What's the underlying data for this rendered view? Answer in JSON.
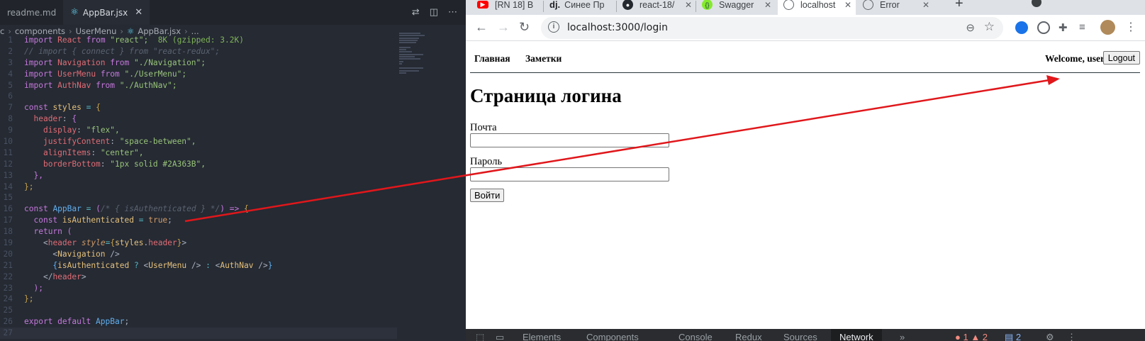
{
  "editor": {
    "tabs": [
      {
        "label": "readme.md"
      },
      {
        "label": "AppBar.jsx"
      }
    ],
    "breadcrumb": [
      "c",
      "components",
      "UserMenu",
      "AppBar.jsx",
      "..."
    ],
    "lines": [
      {
        "n": "1"
      },
      {
        "n": "2"
      },
      {
        "n": "3"
      },
      {
        "n": "4"
      },
      {
        "n": "5"
      },
      {
        "n": "6"
      },
      {
        "n": "7"
      },
      {
        "n": "8"
      },
      {
        "n": "9"
      },
      {
        "n": "10"
      },
      {
        "n": "11"
      },
      {
        "n": "12"
      },
      {
        "n": "13"
      },
      {
        "n": "14"
      },
      {
        "n": "15"
      },
      {
        "n": "16"
      },
      {
        "n": "17"
      },
      {
        "n": "18"
      },
      {
        "n": "19"
      },
      {
        "n": "20"
      },
      {
        "n": "21"
      },
      {
        "n": "22"
      },
      {
        "n": "23"
      },
      {
        "n": "24"
      },
      {
        "n": "25"
      },
      {
        "n": "26"
      },
      {
        "n": "27"
      }
    ],
    "code": {
      "l1_import": "import",
      "l1_react": "React",
      "l1_from": "from",
      "l1_str": "\"react\";",
      "l1_hint": "8K (gzipped: 3.2K)",
      "l2": "// import { connect } from \"react-redux\";",
      "l3_name": "Navigation",
      "l3_str": "\"./Navigation\";",
      "l4_name": "UserMenu",
      "l4_str": "\"./UserMenu\";",
      "l5_name": "AuthNav",
      "l5_str": "\"./AuthNav\";",
      "l7": "styles",
      "l8": "header",
      "l9_k": "display",
      "l9_v": "\"flex\",",
      "l10_k": "justifyContent",
      "l10_v": "\"space-between\",",
      "l11_k": "alignItems",
      "l11_v": "\"center\",",
      "l12_k": "borderBottom",
      "l12_v": "\"1px solid #2A363B\",",
      "l16_name": "AppBar",
      "l16_cm": "/* { isAuthenticated } */",
      "l17_var": "isAuthenticated",
      "l17_val": "true",
      "l19_tag": "header",
      "l19_attr": "style",
      "l19_obj": "styles",
      "l19_prop": "header",
      "l20": "Navigation",
      "l21_var": "isAuthenticated",
      "l21_a": "UserMenu",
      "l21_b": "AuthNav",
      "l22": "header",
      "l26_kw": "export default",
      "l26_name": "AppBar"
    }
  },
  "browser": {
    "tabs": [
      {
        "label": "[RN 18] B",
        "icon": "youtube-icon",
        "color": "#ff0000"
      },
      {
        "label": "Синее Пр",
        "prefix": "dj.",
        "icon": "dj-icon"
      },
      {
        "label": "react-18/",
        "icon": "github-icon",
        "color": "#24292f"
      },
      {
        "label": "Swagger",
        "icon": "swagger-icon",
        "color": "#85ea2d"
      },
      {
        "label": "localhost",
        "icon": "globe-icon",
        "color": "#5f6368"
      },
      {
        "label": "Error",
        "icon": "globe-icon",
        "color": "#5f6368"
      }
    ],
    "url": "localhost:3000/login",
    "page": {
      "nav": [
        "Главная",
        "Заметки"
      ],
      "welcome": "Welcome, user",
      "logout": "Logout",
      "heading": "Страница логина",
      "email_label": "Почта",
      "password_label": "Пароль",
      "submit": "Войти"
    },
    "devtools_tabs": [
      "Elements",
      "Components",
      "Console",
      "Redux",
      "Sources",
      "Network",
      "»"
    ],
    "devtools_badges": {
      "errors": "1",
      "warnings": "2",
      "issues": "2"
    }
  },
  "annotation_color": "#e0171b"
}
